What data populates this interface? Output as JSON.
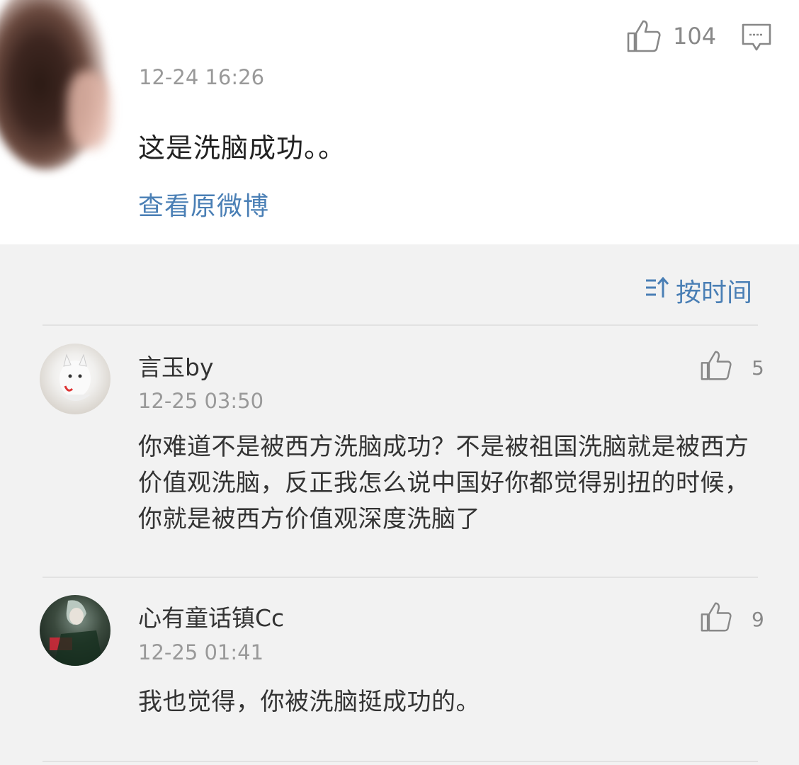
{
  "top_comment": {
    "time": "12-24 16:26",
    "text": "这是洗脑成功。。",
    "view_original_link": "查看原微博",
    "like_count": "104",
    "like_icon": "thumbs-up-icon",
    "comment_icon": "comment-bubble-icon"
  },
  "sort": {
    "label": "按时间",
    "icon": "sort-icon"
  },
  "replies": [
    {
      "username": "言玉by",
      "time": "12-25 03:50",
      "text": "你难道不是被西方洗脑成功？不是被祖国洗脑就是被西方价值观洗脑，反正我怎么说中国好你都觉得别扭的时候，你就是被西方价值观深度洗脑了",
      "like_count": "5"
    },
    {
      "username": "心有童话镇Cc",
      "time": "12-25 01:41",
      "text": "我也觉得，你被洗脑挺成功的。",
      "like_count": "9"
    }
  ],
  "colors": {
    "link": "#4a7fb5",
    "meta": "#999999",
    "background": "#f2f2f2"
  }
}
